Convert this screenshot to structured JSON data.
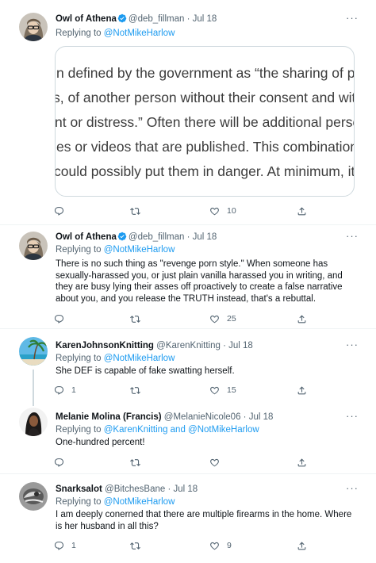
{
  "tweets": [
    {
      "name": "Owl of Athena",
      "handle": "@deb_fillman",
      "date": "Jul 18",
      "replying_label": "Replying to",
      "replying_to": "@NotMikeHarlow",
      "image_lines": [
        "n defined by the government as “the sharing of pr",
        "s, of another person without their consent and with",
        "nt or distress.” Often there will be additional perso",
        "es or videos that are published. This combination",
        "could possibly put them in danger. At minimum, it",
        "."
      ],
      "likes": "10"
    },
    {
      "name": "Owl of Athena",
      "handle": "@deb_fillman",
      "date": "Jul 18",
      "replying_label": "Replying to",
      "replying_to": "@NotMikeHarlow",
      "text": "There is no such thing as \"revenge porn style.\" When someone has sexually-harassed you, or just plain vanilla harassed you in writing, and they are busy lying their asses off proactively to create a false narrative about you, and you release the TRUTH instead, that's a rebuttal.",
      "likes": "25"
    },
    {
      "name": "KarenJohnsonKnitting",
      "handle": "@KarenKnitting",
      "date": "Jul 18",
      "replying_label": "Replying to",
      "replying_to": "@NotMikeHarlow",
      "text": "She DEF is capable of fake swatting herself.",
      "replies": "1",
      "likes": "15"
    },
    {
      "name": "Melanie Molina (Francis)",
      "handle": "@MelanieNicole06",
      "date": "Jul 18",
      "replying_label": "Replying to",
      "replying_to": "@KarenKnitting and @NotMikeHarlow",
      "text": "One-hundred percent!"
    },
    {
      "name": "Snarksalot",
      "handle": "@BitchesBane",
      "date": "Jul 18",
      "replying_label": "Replying to",
      "replying_to": "@NotMikeHarlow",
      "text": "I am deeply conerned that there are multiple firearms in the home. Where is her husband in all this?",
      "replies": "1",
      "likes": "9"
    }
  ],
  "separator": "·",
  "colors": {
    "accent": "#1d9bf0",
    "muted": "#536471",
    "text": "#0f1419",
    "border": "#eff3f4"
  },
  "icons": [
    "reply-icon",
    "retweet-icon",
    "like-icon",
    "share-icon",
    "verified-badge-icon",
    "more-icon"
  ]
}
